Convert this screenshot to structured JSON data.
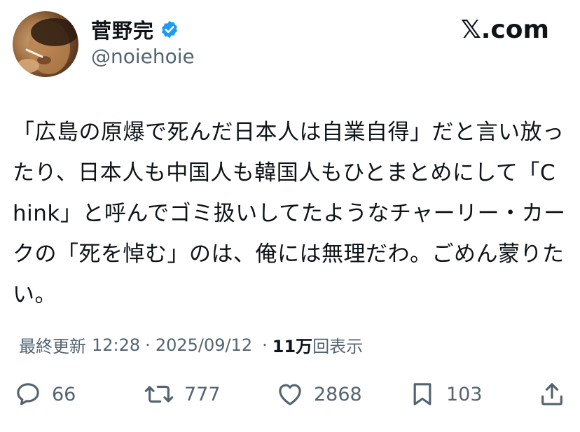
{
  "author": {
    "display_name": "菅野完",
    "handle": "@noiehoie"
  },
  "site_logo": "𝕏.com",
  "tweet": {
    "text": "「広島の原爆で死んだ日本人は自業自得」だと言い放ったり、日本人も中国人も韓国人もひとまとめにして「Chink」と呼んでゴミ扱いしてたようなチャーリー・カークの「死を悼む」のは、俺には無理だわ。ごめん蒙りたい。"
  },
  "meta": {
    "updated_label": "最終更新",
    "time": "12:28",
    "date": "2025/09/12",
    "separator": "·",
    "views_count": "11万",
    "views_label": "回表示"
  },
  "actions": {
    "replies": "66",
    "reposts": "777",
    "likes": "2868",
    "bookmarks": "103"
  },
  "colors": {
    "verified": "#1d9bf0",
    "secondary_text": "#536471",
    "primary_text": "#0f1419"
  }
}
